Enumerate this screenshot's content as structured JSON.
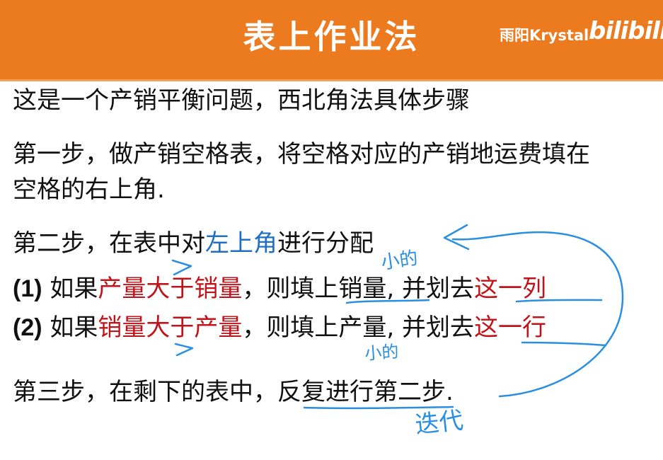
{
  "header": {
    "title": "表上作业法",
    "uploader": "雨阳Krystal",
    "platform": "bilibili",
    "colors": {
      "background": "#ec7a1e",
      "text": "#ffffff"
    }
  },
  "content": {
    "intro": "这是一个产销平衡问题，西北角法具体步骤",
    "step1_line1": "第一步，做产销空格表，将空格对应的产销地运费填在",
    "step1_line2": "空格的右上角.",
    "step2": {
      "before": "第二步，在表中对",
      "highlight": "左上角",
      "after": "进行分配"
    },
    "rule1": {
      "num": "(1)",
      "t1": " 如果",
      "red1": "产量大于销量",
      "t2": "，则填上销量",
      "t3": ", 并划去",
      "red2": "这一列"
    },
    "rule2": {
      "num": "(2)",
      "t1": " 如果",
      "red1": "销量大于产量",
      "t2": "，则填上产量",
      "t3": ", 并划去",
      "red2": "这一行"
    },
    "step3": "第三步，在剩下的表中，反复进行第二步."
  },
  "annotations": {
    "note_small_1": "小的",
    "note_small_2": "小的",
    "note_iterate": "迭代",
    "ink_color": "#2a8fe0"
  },
  "colors": {
    "red": "#c0141a",
    "blue": "#1f6fc2"
  }
}
